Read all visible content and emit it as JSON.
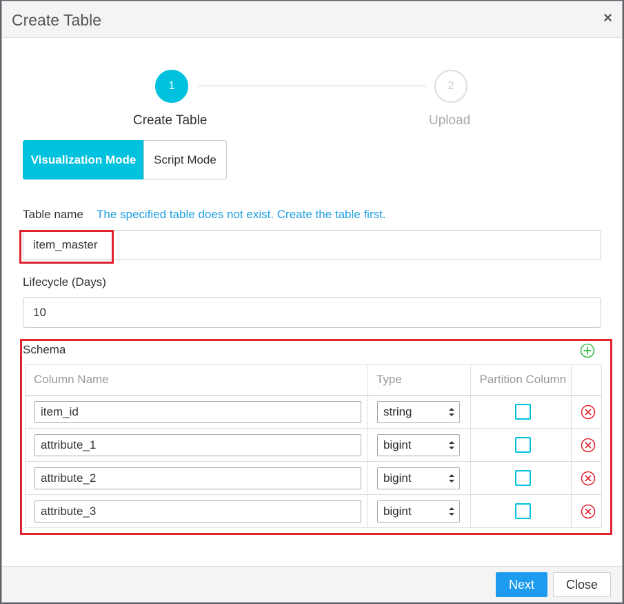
{
  "dialog": {
    "title": "Create Table"
  },
  "steps": [
    {
      "number": "1",
      "label": "Create Table"
    },
    {
      "number": "2",
      "label": "Upload"
    }
  ],
  "modes": {
    "visualization": "Visualization Mode",
    "script": "Script Mode"
  },
  "table_name": {
    "label": "Table name",
    "hint": "The specified table does not exist. Create the table first.",
    "value": "item_master"
  },
  "lifecycle": {
    "label": "Lifecycle (Days)",
    "value": "10"
  },
  "schema": {
    "label": "Schema",
    "headers": {
      "column_name": "Column Name",
      "type": "Type",
      "partition": "Partition Column"
    },
    "rows": [
      {
        "name": "item_id",
        "type": "string"
      },
      {
        "name": "attribute_1",
        "type": "bigint"
      },
      {
        "name": "attribute_2",
        "type": "bigint"
      },
      {
        "name": "attribute_3",
        "type": "bigint"
      }
    ]
  },
  "footer": {
    "next": "Next",
    "close": "Close"
  },
  "colors": {
    "accent": "#00c1de",
    "primary_button": "#1c9bef",
    "hint": "#1f9ee0",
    "highlight": "#e0212e",
    "add": "#3dbd4b",
    "remove": "#e0212e"
  },
  "icons": {
    "close": "close-icon",
    "add": "plus-circle-icon",
    "remove": "x-circle-icon",
    "select": "up-down-chevron-icon"
  }
}
